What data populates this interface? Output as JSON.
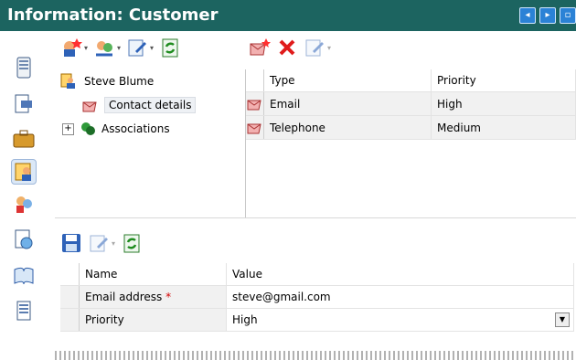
{
  "window": {
    "title": "Information: Customer"
  },
  "nav_icons": [
    "address-card-icon",
    "form-edit-icon",
    "briefcase-icon",
    "customer-icon",
    "people-icon",
    "report-globe-icon",
    "book-icon",
    "document-list-icon"
  ],
  "tree": {
    "root": {
      "label": "Steve Blume"
    },
    "items": [
      {
        "label": "Contact details",
        "selected": true
      },
      {
        "label": "Associations",
        "expand": "+"
      }
    ]
  },
  "contacts_table": {
    "columns": [
      "Type",
      "Priority"
    ],
    "rows": [
      {
        "type": "Email",
        "priority": "High"
      },
      {
        "type": "Telephone",
        "priority": "Medium"
      }
    ]
  },
  "properties_table": {
    "columns": [
      "Name",
      "Value"
    ],
    "rows": [
      {
        "name": "Email address",
        "required_mark": "*",
        "value": "steve@gmail.com"
      },
      {
        "name": "Priority",
        "value": "High"
      }
    ]
  },
  "colors": {
    "titlebar": "#1c6460",
    "accent": "#2b82d6",
    "required": "#d40000"
  }
}
